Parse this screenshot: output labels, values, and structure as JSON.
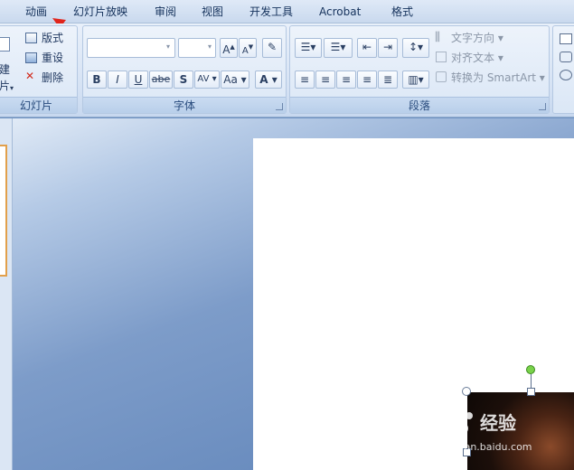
{
  "tabs": [
    {
      "label": "动画"
    },
    {
      "label": "幻灯片放映"
    },
    {
      "label": "审阅"
    },
    {
      "label": "视图"
    },
    {
      "label": "开发工具"
    },
    {
      "label": "Acrobat"
    },
    {
      "label": "格式"
    }
  ],
  "slides_group": {
    "new_slide_partial_top": "建",
    "new_slide_partial_bottom": "片",
    "layout_label": "版式",
    "reset_label": "重设",
    "delete_label": "删除",
    "group_label": "幻灯片"
  },
  "font_group": {
    "font_name": "",
    "font_size": "",
    "bold": "B",
    "italic": "I",
    "underline": "U",
    "strike": "abe",
    "shadow": "S",
    "spacing": "AV",
    "change_case": "Aa",
    "font_color": "A",
    "grow": "A",
    "shrink": "A",
    "group_label": "字体"
  },
  "paragraph_group": {
    "text_direction_label": "文字方向",
    "align_text_label": "对齐文本",
    "smartart_label": "转换为 SmartArt",
    "group_label": "段落"
  },
  "watermark": {
    "brand": "经验",
    "url": "jingyan.baidu.com"
  },
  "colors": {
    "accent_arrow": "#e0251c",
    "selection_border": "#e2a04b",
    "rotation_handle": "#79d24a"
  }
}
